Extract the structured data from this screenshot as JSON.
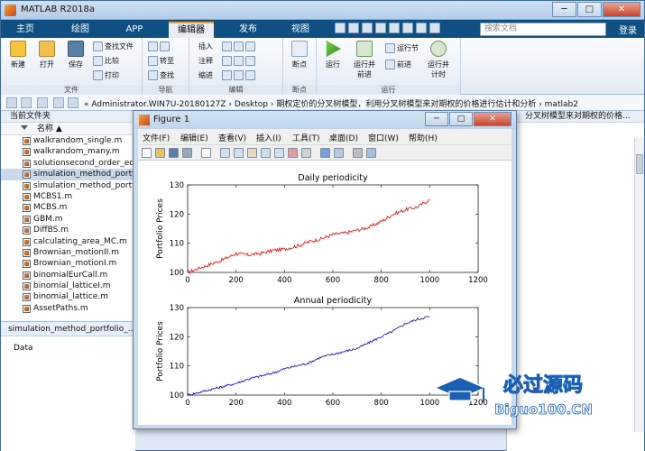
{
  "app": {
    "title": "MATLAB R2018a",
    "tabs": [
      "主页",
      "绘图",
      "APP",
      "编辑器",
      "发布",
      "视图"
    ],
    "search_placeholder": "搜索文档",
    "login": "登录",
    "window_buttons": {
      "minimize": "─",
      "maximize": "□",
      "close": "✕"
    }
  },
  "ribbon": {
    "groups": [
      {
        "label": "文件",
        "big": [
          "新建",
          "打开",
          "保存"
        ],
        "small": [
          "查找文件",
          "比较",
          "打印"
        ]
      },
      {
        "label": "导航",
        "small": [
          "转至",
          "查找"
        ]
      },
      {
        "label": "编辑",
        "small": [
          "插入",
          "注释",
          "缩进"
        ]
      },
      {
        "label": "断点",
        "big": [
          "断点"
        ]
      },
      {
        "label": "运行",
        "big": [
          "运行",
          "运行并前进",
          "运行节",
          "前进",
          "运行并计时"
        ]
      }
    ]
  },
  "address": {
    "path": "«  Administrator.WIN7U-20180127Z  ›  Desktop  ›  期权定价的分叉树模型，利用分叉树模型来对期权的价格进行估计和分析  ›  matlab2"
  },
  "current_folder": {
    "header": "当前文件夹",
    "column": "名称 ▲",
    "files": [
      "walkrandom_single.m",
      "walkrandom_many.m",
      "solutionsecond_order_eq...",
      "simulation_method_portfolio...",
      "simulation_method_portfolio...",
      "MCBS1.m",
      "MCBS.m",
      "GBM.m",
      "DiffBS.m",
      "calculating_area_MC.m",
      "Brownian_motionII.m",
      "Brownian_motionI.m",
      "binomialEurCall.m",
      "binomial_latticeI.m",
      "binomial_lattice.m",
      "AssetPaths.m"
    ],
    "selected_index": 3
  },
  "details": {
    "filename": "simulation_method_portfolio_...",
    "label": "Data"
  },
  "right_panel": {
    "header": "分叉树模型来对期权的价格..."
  },
  "figure": {
    "title": "Figure 1",
    "menu": [
      "文件(F)",
      "编辑(E)",
      "查看(V)",
      "插入(I)",
      "工具(T)",
      "桌面(D)",
      "窗口(W)",
      "帮助(H)"
    ],
    "toolbar_icons": [
      "new-icon",
      "open-icon",
      "save-icon",
      "print-icon",
      "pointer-icon",
      "zoom-in-icon",
      "zoom-out-icon",
      "pan-icon",
      "rotate-icon",
      "datacursor-icon",
      "brush-icon",
      "link-icon",
      "colorbar-icon",
      "legend-icon",
      "hide-icon",
      "show-icon"
    ]
  },
  "watermark": {
    "brand": "必过源码",
    "site": "Biguo100.CN"
  },
  "chart_data": [
    {
      "type": "line",
      "title": "Daily periodicity",
      "xlabel": "",
      "ylabel": "Portfolio Prices",
      "xlim": [
        0,
        1200
      ],
      "ylim": [
        100,
        130
      ],
      "xticks": [
        0,
        200,
        400,
        600,
        800,
        1000,
        1200
      ],
      "yticks": [
        100,
        110,
        120,
        130
      ],
      "color": "#ff0000",
      "series": [
        {
          "name": "",
          "x": [
            0,
            50,
            100,
            150,
            200,
            250,
            300,
            350,
            400,
            450,
            500,
            550,
            600,
            650,
            700,
            750,
            800,
            850,
            900,
            950,
            1000
          ],
          "y": [
            100,
            101.5,
            103,
            104.5,
            106.5,
            106,
            106.5,
            107.5,
            108,
            109,
            110.5,
            111.5,
            113,
            113.5,
            114.5,
            115.5,
            117.5,
            120,
            121.5,
            122.5,
            125
          ]
        }
      ]
    },
    {
      "type": "line",
      "title": "Annual periodicity",
      "xlabel": "",
      "ylabel": "Portfolio Prices",
      "xlim": [
        0,
        1200
      ],
      "ylim": [
        100,
        130
      ],
      "xticks": [
        0,
        200,
        400,
        600,
        800,
        1000,
        1200
      ],
      "yticks": [
        100,
        110,
        120,
        130
      ],
      "color": "#0000cc",
      "series": [
        {
          "name": "",
          "x": [
            0,
            50,
            100,
            150,
            200,
            250,
            300,
            350,
            400,
            450,
            500,
            550,
            600,
            650,
            700,
            750,
            800,
            850,
            900,
            950,
            1000
          ],
          "y": [
            100,
            101,
            102,
            103,
            104,
            105.5,
            106.5,
            107.5,
            109,
            110,
            111,
            113,
            114,
            115,
            116,
            118,
            120,
            122,
            124.5,
            126,
            127
          ]
        }
      ]
    }
  ]
}
